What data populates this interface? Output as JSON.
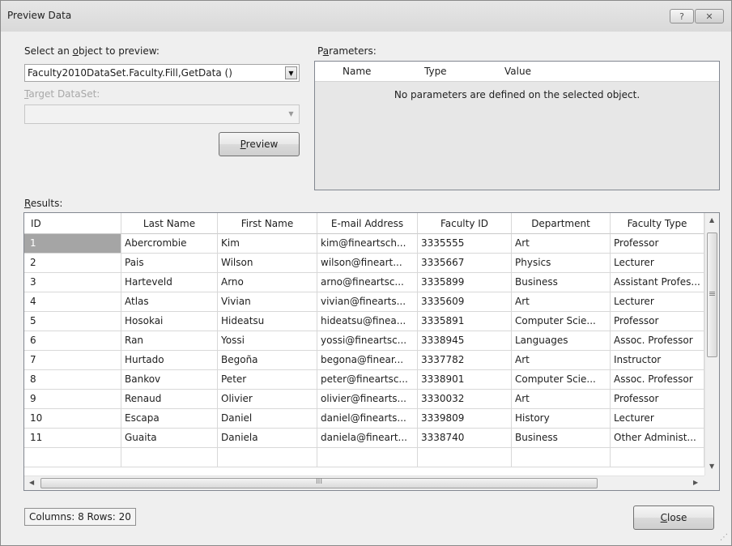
{
  "window": {
    "title": "Preview Data",
    "help_glyph": "?",
    "close_glyph": "✕"
  },
  "object_select": {
    "label_pre": "Select an ",
    "label_mnemonic": "o",
    "label_post": "bject to preview:",
    "value": "Faculty2010DataSet.Faculty.Fill,GetData ()"
  },
  "target_dataset": {
    "label_mnemonic": "T",
    "label_post": "arget DataSet:",
    "value": ""
  },
  "preview_button": {
    "mnemonic": "P",
    "rest": "review"
  },
  "parameters": {
    "label_pre": "P",
    "label_mnemonic": "a",
    "label_post": "rameters:",
    "columns": [
      "Name",
      "Type",
      "Value"
    ],
    "empty_message": "No parameters are defined on the selected object."
  },
  "results": {
    "label_mnemonic": "R",
    "label_post": "esults:",
    "columns": [
      "ID",
      "Last Name",
      "First Name",
      "E-mail Address",
      "Faculty ID",
      "Department",
      "Faculty Type"
    ],
    "rows": [
      [
        "1",
        "Abercrombie",
        "Kim",
        "kim@fineartsch...",
        "3335555",
        "Art",
        "Professor"
      ],
      [
        "2",
        "Pais",
        "Wilson",
        "wilson@fineart...",
        "3335667",
        "Physics",
        "Lecturer"
      ],
      [
        "3",
        "Harteveld",
        "Arno",
        "arno@fineartsc...",
        "3335899",
        "Business",
        "Assistant Profes..."
      ],
      [
        "4",
        "Atlas",
        "Vivian",
        "vivian@finearts...",
        "3335609",
        "Art",
        "Lecturer"
      ],
      [
        "5",
        "Hosokai",
        "Hideatsu",
        "hideatsu@finea...",
        "3335891",
        "Computer Scie...",
        "Professor"
      ],
      [
        "6",
        "Ran",
        " Yossi",
        "yossi@fineartsc...",
        "3338945",
        "Languages",
        "Assoc. Professor"
      ],
      [
        "7",
        "Hurtado",
        "Begoña",
        "begona@finear...",
        "3337782",
        "Art",
        "Instructor"
      ],
      [
        "8",
        "Bankov",
        "Peter",
        "peter@fineartsc...",
        "3338901",
        "Computer Scie...",
        "Assoc. Professor"
      ],
      [
        "9",
        "Renaud",
        "Olivier",
        "olivier@finearts...",
        "3330032",
        "Art",
        "Professor"
      ],
      [
        "10",
        "Escapa",
        "Daniel",
        "daniel@finearts...",
        "3339809",
        "History",
        "Lecturer"
      ],
      [
        "11",
        "Guaita",
        "Daniela",
        "daniela@fineart...",
        "3338740",
        "Business",
        "Other Administ..."
      ],
      [
        "",
        "",
        "",
        "",
        "",
        "",
        ""
      ]
    ],
    "scroll_glyphs": {
      "up": "▲",
      "down": "▼",
      "left": "◀",
      "right": "▶",
      "grip_v": "≡",
      "grip_h": "III"
    }
  },
  "status": {
    "text": "Columns: 8   Rows: 20"
  },
  "close_button": {
    "mnemonic": "C",
    "rest": "lose"
  },
  "colors": {
    "dialog_bg": "#efefef",
    "selected_cell": "#a5a5a5",
    "grid_line": "#d8d8d8"
  }
}
